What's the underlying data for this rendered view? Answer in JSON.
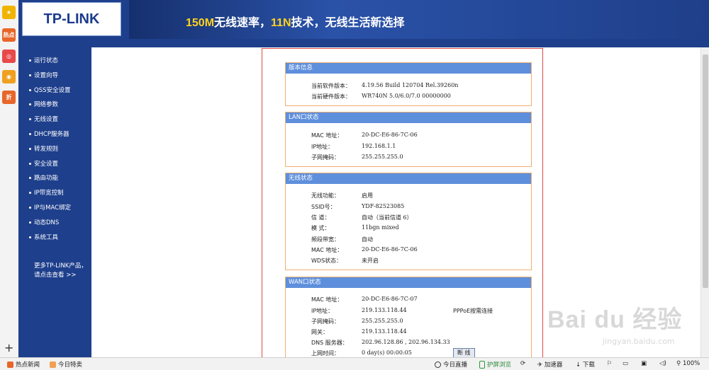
{
  "browser": {
    "dock_buttons": [
      {
        "name": "favorites-star-icon",
        "glyph": "★",
        "color": "#f0b400"
      },
      {
        "name": "hot-news-icon",
        "glyph": "热点",
        "color": "#e8662a"
      },
      {
        "name": "target-icon",
        "glyph": "◎",
        "color": "#e84a4a"
      },
      {
        "name": "weibo-icon",
        "glyph": "◉",
        "color": "#f0a020"
      },
      {
        "name": "discount-icon",
        "glyph": "折",
        "color": "#e8662a"
      }
    ],
    "add_glyph": "+",
    "status": {
      "hot_news": "热点新闻",
      "daily_special": "今日特卖",
      "today_live": "今日直播",
      "protect_eye": "护屏浏览",
      "accelerator": "加速器",
      "download": "下载",
      "zoom": "100%"
    }
  },
  "router": {
    "logo": "TP-LINK",
    "slogan_parts": [
      "150M",
      "无线速率，",
      "11N",
      "技术，无线生活新选择"
    ],
    "nav": [
      "运行状态",
      "设置向导",
      "QSS安全设置",
      "网络参数",
      "无线设置",
      "DHCP服务器",
      "转发规则",
      "安全设置",
      "路由功能",
      "IP带宽控制",
      "IP与MAC绑定",
      "动态DNS",
      "系统工具"
    ],
    "more": [
      "更多TP-LINK产品，",
      "请点击查看 >>"
    ],
    "version": {
      "title": "版本信息",
      "rows": [
        {
          "label": "当前软件版本：",
          "value": "4.19.56 Build 120704 Rel.39260n"
        },
        {
          "label": "当前硬件版本：",
          "value": "WR740N 5.0/6.0/7.0 00000000"
        }
      ]
    },
    "lan": {
      "title": "LAN口状态",
      "rows": [
        {
          "label": "MAC 地址：",
          "value": "20-DC-E6-86-7C-06"
        },
        {
          "label": "IP地址：",
          "value": "192.168.1.1"
        },
        {
          "label": "子网掩码：",
          "value": "255.255.255.0"
        }
      ]
    },
    "wireless": {
      "title": "无线状态",
      "rows": [
        {
          "label": "无线功能：",
          "value": "启用"
        },
        {
          "label": "SSID号：",
          "value": "YDF-82523085"
        },
        {
          "label": "信 道：",
          "value": "自动（当前信道 6）"
        },
        {
          "label": "模 式：",
          "value": "11bgn mixed"
        },
        {
          "label": "频段带宽：",
          "value": "自动"
        },
        {
          "label": "MAC 地址：",
          "value": "20-DC-E6-86-7C-06"
        },
        {
          "label": "WDS状态：",
          "value": "未开启"
        }
      ]
    },
    "wan": {
      "title": "WAN口状态",
      "rows": [
        {
          "label": "MAC 地址：",
          "value": "20-DC-E6-86-7C-07"
        },
        {
          "label": "IP地址：",
          "value": "219.133.118.44"
        },
        {
          "label": "子网掩码：",
          "value": "255.255.255.0"
        },
        {
          "label": "网关：",
          "value": "219.133.118.44"
        },
        {
          "label": "DNS 服务器：",
          "value": "202.96.128.86 , 202.96.134.33"
        },
        {
          "label": "上网时间：",
          "value": "0 day(s) 00:00:05"
        }
      ],
      "conn_type": "PPPoE按需连接",
      "disconnect": "断 线"
    }
  },
  "watermark": {
    "line1": "Bai du 经验",
    "line2": "jingyan.baidu.com"
  }
}
